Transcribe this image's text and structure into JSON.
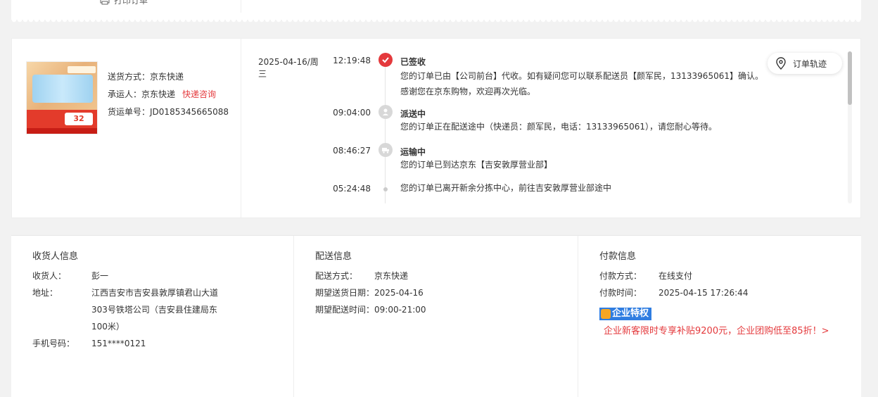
{
  "top": {
    "print_label": "打印订单"
  },
  "shipping": {
    "method_label": "送货方式：",
    "method_value": "京东快递",
    "carrier_label": "承运人：",
    "carrier_value": "京东快递",
    "carrier_link": "快递咨询",
    "tracking_label": "货运单号：",
    "tracking_value": "JD0185345665088",
    "product_badge": "32",
    "track_button": "订单轨迹"
  },
  "timeline": [
    {
      "date": "2025-04-16/周三",
      "time": "12:19:48",
      "title": "已签收",
      "desc": "您的订单已由【公司前台】代收。如有疑问您可以联系配送员【颜军民，13133965061】确认。感谢您在京东购物，欢迎再次光临。",
      "icon": "check-icon",
      "state": "red"
    },
    {
      "date": "",
      "time": "09:04:00",
      "title": "派送中",
      "desc": "您的订单正在配送途中（快递员：颜军民，电话：13133965061），请您耐心等待。",
      "icon": "delivery-icon",
      "state": "grey"
    },
    {
      "date": "",
      "time": "08:46:27",
      "title": "运输中",
      "desc": "您的订单已到达京东【吉安敦厚营业部】",
      "icon": "truck-icon",
      "state": "grey"
    },
    {
      "date": "",
      "time": "05:24:48",
      "title": "",
      "desc": "您的订单已离开新余分拣中心，前往吉安敦厚营业部途中",
      "icon": "dot-icon",
      "state": "small"
    }
  ],
  "receiver": {
    "title": "收货人信息",
    "name_label": "收货人：",
    "name_value": "彭一",
    "address_label": "地址：",
    "address_value": "江西吉安市吉安县敦厚镇君山大道303号铁塔公司（吉安县住建局东100米）",
    "phone_label": "手机号码：",
    "phone_value": "151****0121"
  },
  "delivery": {
    "title": "配送信息",
    "method_label": "配送方式：",
    "method_value": "京东快递",
    "date_label": "期望送货日期：",
    "date_value": "2025-04-16",
    "time_label": "期望配送时间：",
    "time_value": "09:00-21:00"
  },
  "payment": {
    "title": "付款信息",
    "method_label": "付款方式：",
    "method_value": "在线支付",
    "time_label": "付款时间：",
    "time_value": "2025-04-15 17:26:44",
    "enterprise_badge": "企业特权",
    "enterprise_link": "企业新客限时专享补贴9200元，企业团购低至85折！>"
  },
  "colors": {
    "accent": "#e4393c",
    "enterprise_blue": "#2f7de1"
  }
}
